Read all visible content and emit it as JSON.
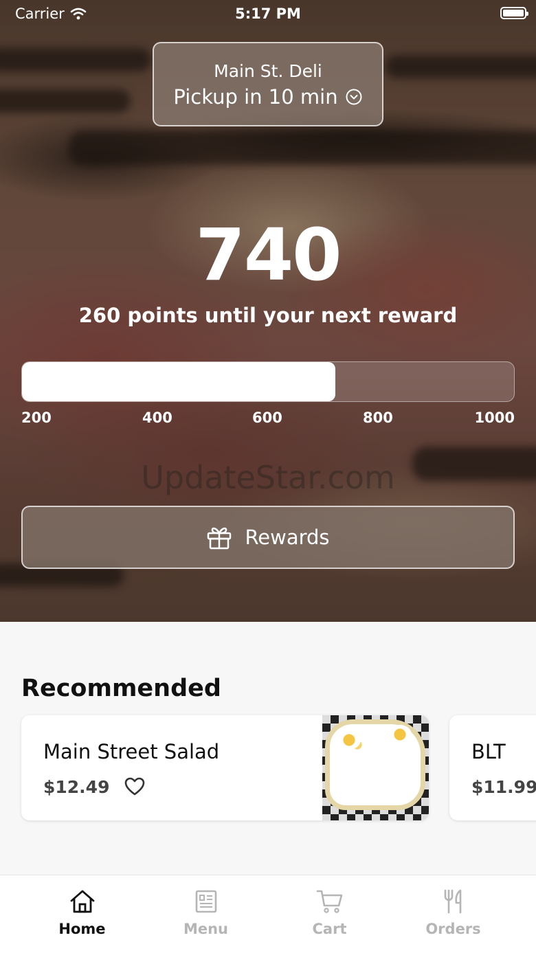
{
  "status_bar": {
    "carrier": "Carrier",
    "time": "5:17 PM"
  },
  "store": {
    "name": "Main St. Deli",
    "pickup": "Pickup in 10 min"
  },
  "points": {
    "value": "740",
    "subtitle": "260 points until your next reward",
    "progress_fraction": 0.6375,
    "scale_labels": [
      "200",
      "400",
      "600",
      "800",
      "1000"
    ]
  },
  "watermark": "UpdateStar.com",
  "rewards_button": {
    "label": "Rewards",
    "icon": "gift-icon"
  },
  "recommended": {
    "title": "Recommended",
    "items": [
      {
        "name": "Main Street Salad",
        "price": "$12.49",
        "icon": "heart-icon"
      },
      {
        "name": "BLT",
        "price": "$11.99"
      }
    ]
  },
  "tab_bar": {
    "tabs": [
      {
        "label": "Home",
        "icon": "home-icon",
        "active": true
      },
      {
        "label": "Menu",
        "icon": "menu-icon",
        "active": false
      },
      {
        "label": "Cart",
        "icon": "cart-icon",
        "active": false
      },
      {
        "label": "Orders",
        "icon": "utensils-icon",
        "active": false
      }
    ]
  },
  "colors": {
    "active_tab": "#111111",
    "inactive_tab": "#b5b5b5",
    "page_bg": "#f7f7f7"
  }
}
